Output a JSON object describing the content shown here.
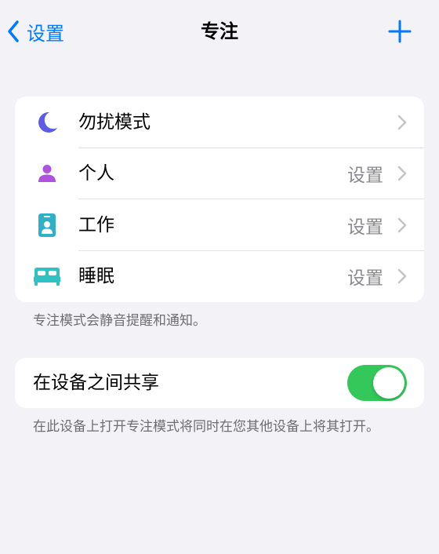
{
  "navbar": {
    "back_label": "设置",
    "title": "专注",
    "add_icon": "plus-icon",
    "accent_color": "#007aff"
  },
  "modes": {
    "items": [
      {
        "label": "勿扰模式",
        "value": "",
        "icon": "moon-icon",
        "icon_color": "#5e5ce6"
      },
      {
        "label": "个人",
        "value": "设置",
        "icon": "person-icon",
        "icon_color": "#af52de"
      },
      {
        "label": "工作",
        "value": "设置",
        "icon": "id-badge-icon",
        "icon_color": "#30b0c7"
      },
      {
        "label": "睡眠",
        "value": "设置",
        "icon": "bed-icon",
        "icon_color": "#30c2c2"
      }
    ],
    "footnote": "专注模式会静音提醒和通知。"
  },
  "share": {
    "label": "在设备之间共享",
    "toggle_on": true,
    "toggle_color": "#34c759",
    "footnote": "在此设备上打开专注模式将同时在您其他设备上将其打开。"
  }
}
